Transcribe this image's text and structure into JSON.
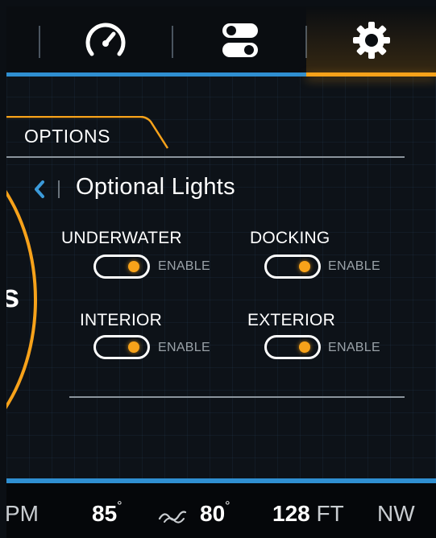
{
  "nav": {
    "tabs": [
      {
        "icon": "speedometer-icon",
        "active": false
      },
      {
        "icon": "toggle-switches-icon",
        "active": false
      },
      {
        "icon": "gear-icon",
        "active": true
      }
    ]
  },
  "gauge": {
    "partial_text": "s"
  },
  "options": {
    "label": "OPTIONS"
  },
  "header": {
    "back_icon": "chevron-left-icon",
    "title": "Optional Lights"
  },
  "lights": [
    {
      "label": "UNDERWATER",
      "toggle_label": "ENABLE",
      "enabled": true
    },
    {
      "label": "DOCKING",
      "toggle_label": "ENABLE",
      "enabled": true
    },
    {
      "label": "INTERIOR",
      "toggle_label": "ENABLE",
      "enabled": true
    },
    {
      "label": "EXTERIOR",
      "toggle_label": "ENABLE",
      "enabled": true
    }
  ],
  "footer": {
    "time_suffix": "PM",
    "air_temp": "85",
    "water_temp": "80",
    "water_icon": "water-wave-icon",
    "depth_value": "128",
    "depth_unit": "FT",
    "heading": "NW",
    "degree_symbol": "°"
  },
  "colors": {
    "accent": "#f7a21a",
    "blue": "#2f8fd1",
    "background": "#0d1218"
  }
}
